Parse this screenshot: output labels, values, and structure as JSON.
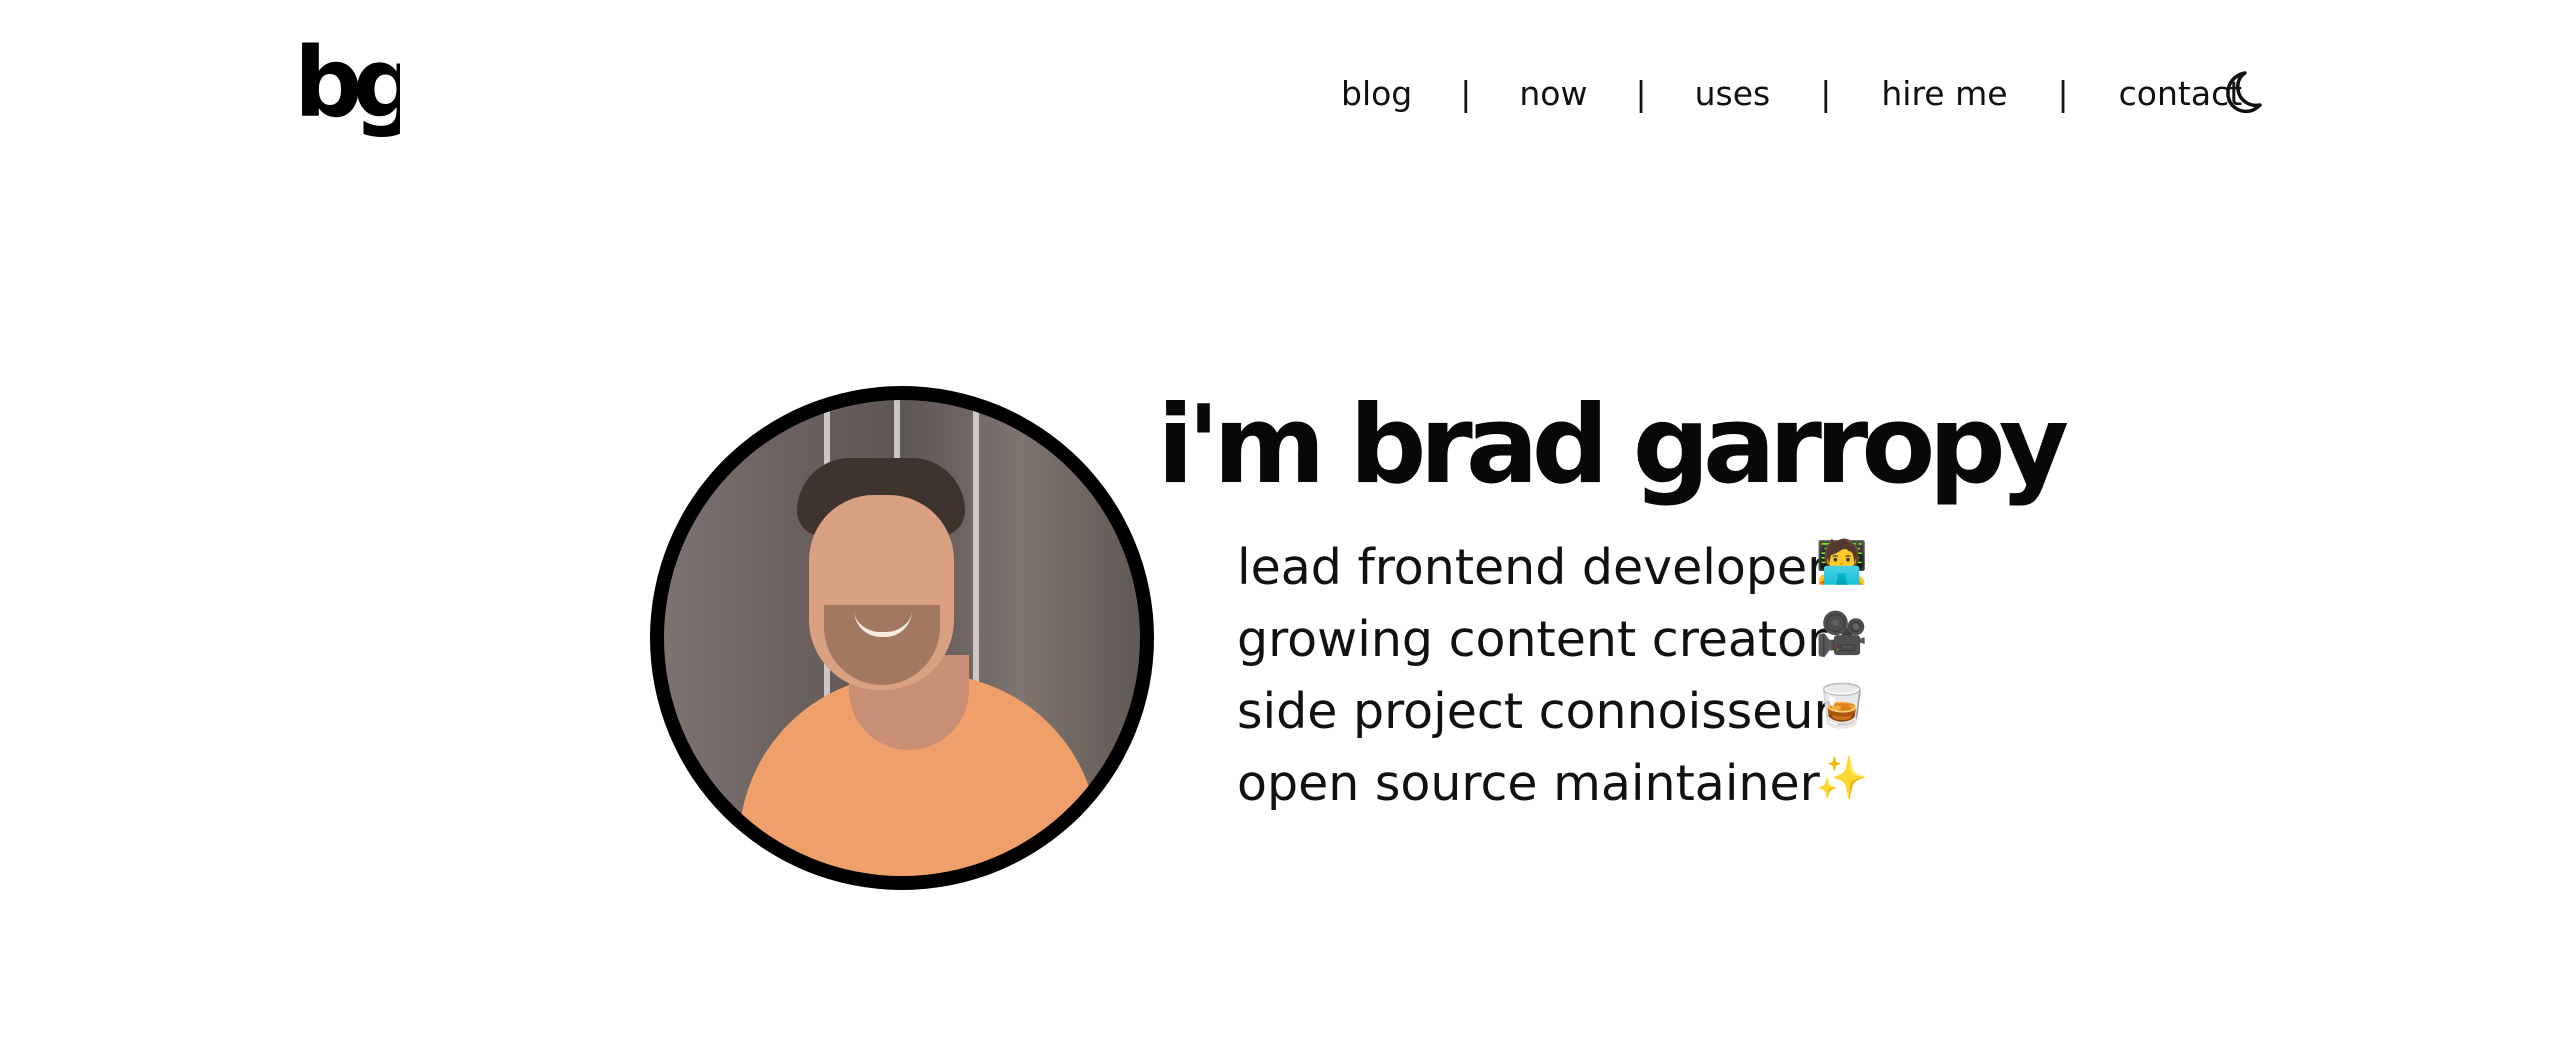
{
  "brand": {
    "logo_text": "bg"
  },
  "header": {
    "nav": [
      {
        "label": "blog"
      },
      {
        "label": "now"
      },
      {
        "label": "uses"
      },
      {
        "label": "hire me"
      },
      {
        "label": "contact"
      }
    ],
    "separator": "|",
    "theme_icon": "moon-icon"
  },
  "hero": {
    "title": "i'm brad garropy",
    "roles": [
      {
        "text": "lead frontend developer",
        "emoji": "🧑‍💻"
      },
      {
        "text": "growing content creator",
        "emoji": "🎥"
      },
      {
        "text": "side project connoisseur",
        "emoji": "🥃"
      },
      {
        "text": "open source maintainer",
        "emoji": "✨"
      }
    ]
  },
  "colors": {
    "background": "#ffffff",
    "text": "#111111",
    "avatar_border": "#000000",
    "shirt": "#ee9f6a"
  }
}
